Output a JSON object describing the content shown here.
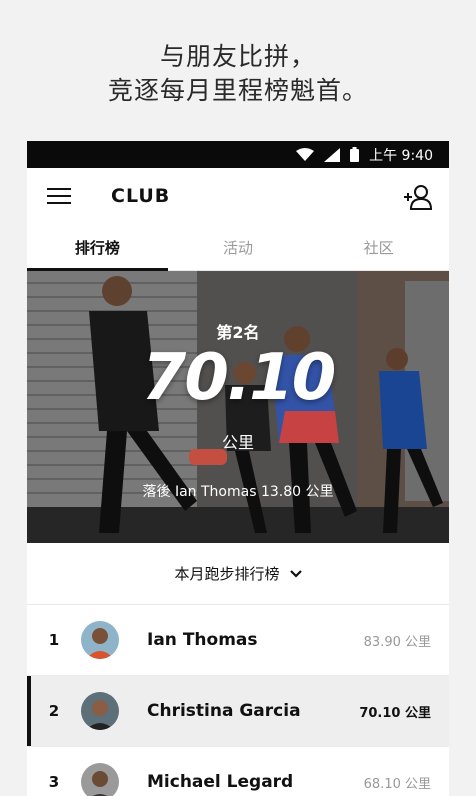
{
  "tagline": {
    "line1": "与朋友比拼，",
    "line2": "竞逐每月里程榜魁首。"
  },
  "status_bar": {
    "time": "上午 9:40",
    "icons": [
      "wifi-icon",
      "signal-icon",
      "battery-icon"
    ]
  },
  "app_bar": {
    "title": "CLUB",
    "icons": [
      "hamburger-menu-icon",
      "add-friend-icon"
    ]
  },
  "tabs": [
    {
      "label": "排行榜",
      "active": true
    },
    {
      "label": "活动",
      "active": false
    },
    {
      "label": "社区",
      "active": false
    }
  ],
  "hero": {
    "rank": "第2名",
    "value": "70.10",
    "unit": "公里",
    "behind_text": "落後 Ian Thomas 13.80 公里"
  },
  "selector": {
    "label": "本月跑步排行榜",
    "icon": "chevron-down-icon"
  },
  "leaderboard": [
    {
      "rank": "1",
      "name": "Ian Thomas",
      "distance": "83.90 公里",
      "highlight": false
    },
    {
      "rank": "2",
      "name": "Christina Garcia",
      "distance": "70.10 公里",
      "highlight": true
    },
    {
      "rank": "3",
      "name": "Michael Legard",
      "distance": "68.10 公里",
      "highlight": false
    }
  ],
  "colors": {
    "accent": "#111111",
    "status_bar": "#0a0a0a",
    "highlight_row": "#eeeeee",
    "muted_text": "#999999"
  }
}
